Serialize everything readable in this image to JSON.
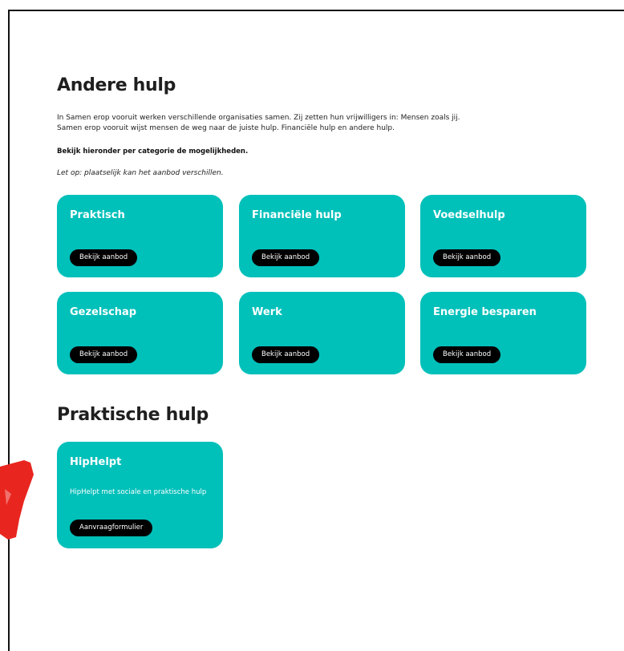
{
  "section_andere": {
    "title": "Andere hulp",
    "intro_line1": "In Samen erop vooruit werken verschillende organisaties samen. Zij zetten hun vrijwilligers in:  Mensen zoals jij.",
    "intro_line2": "Samen erop vooruit wijst mensen de weg naar de juiste hulp. Financiële hulp en andere hulp.",
    "bold_line": "Bekijk hieronder per categorie de mogelijkheden.",
    "italic_line": "Let op: plaatselijk kan het aanbod verschillen."
  },
  "categories": [
    {
      "title": "Praktisch",
      "button": "Bekijk aanbod"
    },
    {
      "title": "Financiële hulp",
      "button": "Bekijk aanbod"
    },
    {
      "title": "Voedselhulp",
      "button": "Bekijk aanbod"
    },
    {
      "title": "Gezelschap",
      "button": "Bekijk aanbod"
    },
    {
      "title": "Werk",
      "button": "Bekijk aanbod"
    },
    {
      "title": "Energie besparen",
      "button": "Bekijk aanbod"
    }
  ],
  "section_praktische": {
    "title": "Praktische hulp",
    "card": {
      "title": "HipHelpt",
      "description": "HipHelpt met sociale en praktische hulp",
      "button": "Aanvraagformulier"
    }
  },
  "colors": {
    "card_bg": "#00c0ba",
    "button_bg": "#000000",
    "annotation": "#e8261f"
  },
  "annotation_icon": "red-brush-stroke-arrow"
}
